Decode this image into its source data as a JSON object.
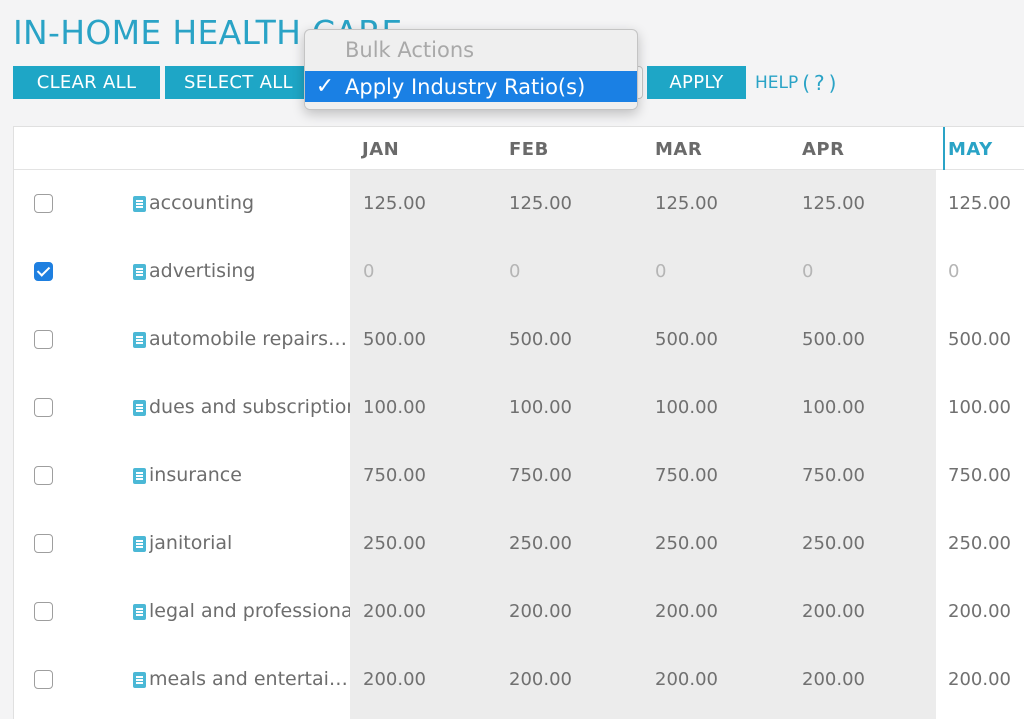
{
  "page": {
    "title": "IN-HOME HEALTH CARE"
  },
  "toolbar": {
    "clear_all": "CLEAR ALL",
    "select_all": "SELECT ALL",
    "apply": "APPLY",
    "help_label": "HELP",
    "help_mark": "(?)"
  },
  "dropdown": {
    "options": [
      {
        "label": "Bulk Actions",
        "disabled": true
      },
      {
        "label": "Apply Industry Ratio(s)",
        "selected": true,
        "check": "✓"
      }
    ]
  },
  "table": {
    "months": [
      "JAN",
      "FEB",
      "MAR",
      "APR",
      "MAY"
    ],
    "current_month": "MAY",
    "rows": [
      {
        "label": "accounting",
        "checked": false,
        "values": [
          "125.00",
          "125.00",
          "125.00",
          "125.00",
          "125.00"
        ]
      },
      {
        "label": "advertising",
        "checked": true,
        "values": [
          "0",
          "0",
          "0",
          "0",
          "0"
        ]
      },
      {
        "label": "automobile repairs and maintenance",
        "checked": false,
        "values": [
          "500.00",
          "500.00",
          "500.00",
          "500.00",
          "500.00"
        ]
      },
      {
        "label": "dues and subscriptions",
        "checked": false,
        "values": [
          "100.00",
          "100.00",
          "100.00",
          "100.00",
          "100.00"
        ]
      },
      {
        "label": "insurance",
        "checked": false,
        "values": [
          "750.00",
          "750.00",
          "750.00",
          "750.00",
          "750.00"
        ]
      },
      {
        "label": "janitorial",
        "checked": false,
        "values": [
          "250.00",
          "250.00",
          "250.00",
          "250.00",
          "250.00"
        ]
      },
      {
        "label": "legal and professional",
        "checked": false,
        "values": [
          "200.00",
          "200.00",
          "200.00",
          "200.00",
          "200.00"
        ]
      },
      {
        "label": "meals and entertainment",
        "checked": false,
        "values": [
          "200.00",
          "200.00",
          "200.00",
          "200.00",
          "200.00"
        ]
      }
    ]
  },
  "colors": {
    "accent": "#1ea6c6",
    "title": "#2aa3c6",
    "selection": "#1a80e4",
    "shade": "#ececec"
  }
}
